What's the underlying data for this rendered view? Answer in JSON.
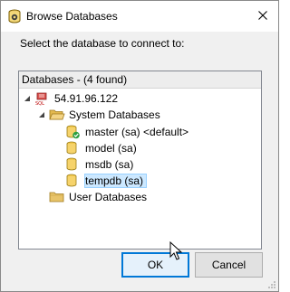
{
  "window": {
    "title": "Browse Databases",
    "prompt": "Select the database to connect to:"
  },
  "tree": {
    "header": "Databases - (4 found)",
    "server": "54.91.96.122",
    "system_folder": "System Databases",
    "databases": [
      {
        "label": "master (sa) <default>",
        "status": "connected"
      },
      {
        "label": "model (sa)"
      },
      {
        "label": "msdb (sa)"
      },
      {
        "label": "tempdb (sa)",
        "selected": true
      }
    ],
    "user_folder": "User Databases"
  },
  "buttons": {
    "ok": "OK",
    "cancel": "Cancel"
  },
  "icons": {
    "app": "database-app-icon",
    "server": "sql-server-icon",
    "folder": "folder-icon",
    "database": "database-cylinder-icon",
    "check": "green-check-icon"
  },
  "colors": {
    "selection": "#cce8ff",
    "folder": "#e8c46a",
    "database": "#f2c94c",
    "check": "#2ea043",
    "accent": "#0078d7"
  }
}
